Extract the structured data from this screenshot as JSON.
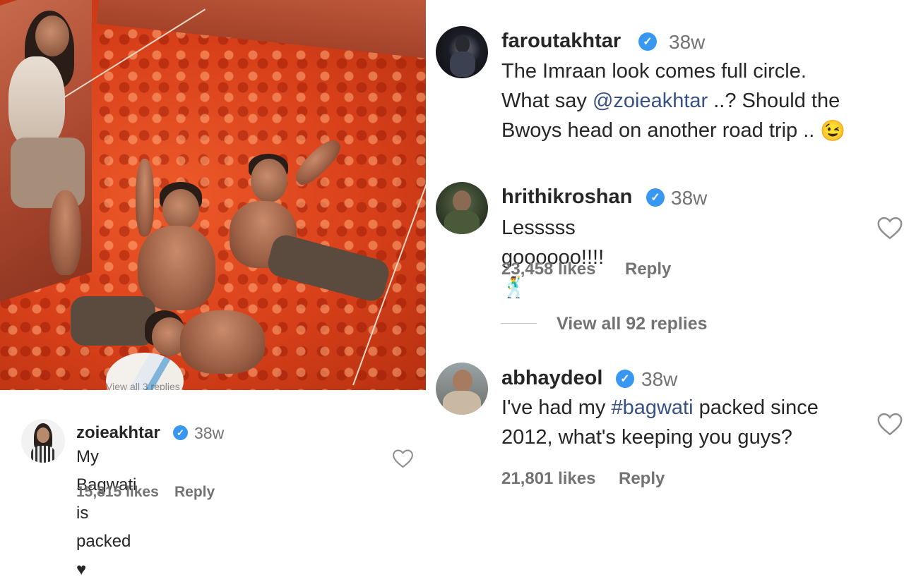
{
  "photo": {
    "overlay_text": "View all 3 replies"
  },
  "comments": [
    {
      "username": "faroutakhtar",
      "time": "38w",
      "text_pre": "The Imraan look comes full circle.",
      "text_line2_pre": "What say ",
      "mention": "@zoieakhtar",
      "text_line2_post": " ..? Should the",
      "text_line3": "Bwoys head on another road trip ..",
      "emoji": "😉"
    },
    {
      "username": "hrithikroshan",
      "time": "38w",
      "text": "Lesssss goooooo!!!!",
      "emoji": "🕺",
      "likes": "23,458 likes",
      "reply": "Reply",
      "view_replies": "View all 92 replies"
    },
    {
      "username": "abhaydeol",
      "time": "38w",
      "text_pre": "I've had my ",
      "hashtag": "#bagwati",
      "text_post": " packed since",
      "text_line2": "2012, what's keeping you guys?",
      "likes": "21,801 likes",
      "reply": "Reply"
    },
    {
      "username": "zoieakhtar",
      "time": "38w",
      "text": "My Bagwati is packed ♥",
      "likes": "15,815 likes",
      "reply": "Reply"
    }
  ],
  "colors": {
    "verified": "#3897f0",
    "mention": "#385185",
    "meta": "#737373"
  },
  "icons": [
    "verified-badge-icon",
    "heart-outline-icon"
  ]
}
